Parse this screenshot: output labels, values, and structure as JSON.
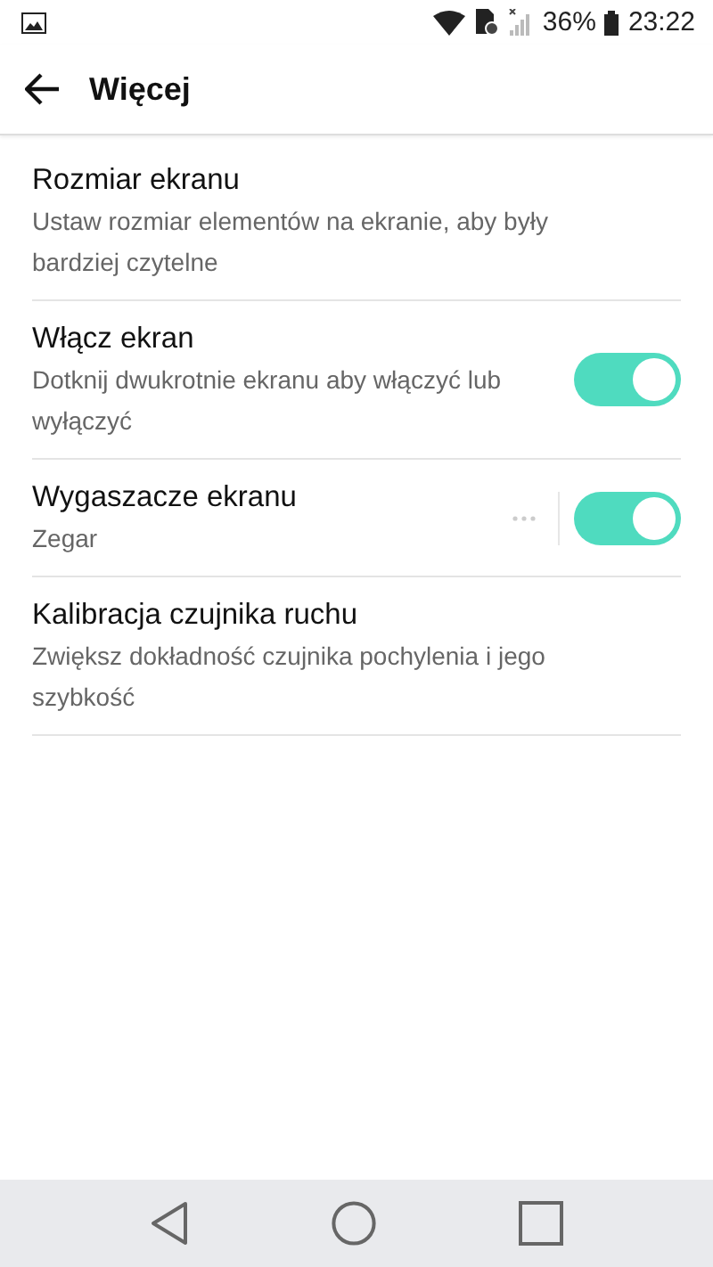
{
  "status_bar": {
    "battery_text": "36%",
    "time": "23:22"
  },
  "toolbar": {
    "title": "Więcej"
  },
  "settings": [
    {
      "kind": "text",
      "title": "Rozmiar ekranu",
      "summary": "Ustaw rozmiar elementów na ekranie, aby były bardziej czytelne"
    },
    {
      "kind": "toggle",
      "title": "Włącz ekran",
      "summary": "Dotknij dwukrotnie ekranu aby włączyć lub wyłączyć",
      "on": true
    },
    {
      "kind": "toggle-more",
      "title": "Wygaszacze ekranu",
      "summary": "Zegar",
      "on": true
    },
    {
      "kind": "text",
      "title": "Kalibracja czujnika ruchu",
      "summary": "Zwiększ dokładność czujnika pochylenia i jego szybkość"
    }
  ]
}
